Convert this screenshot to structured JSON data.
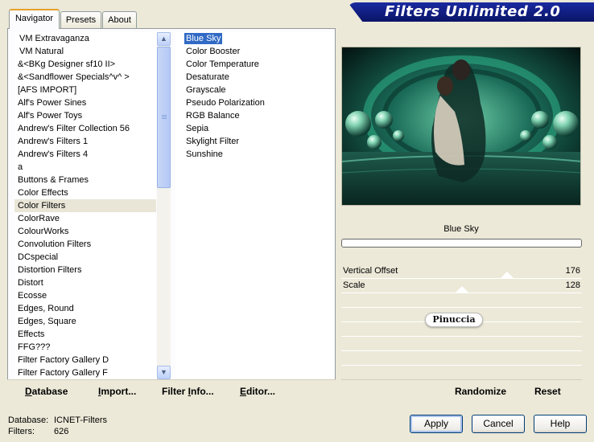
{
  "banner": {
    "title": "Filters Unlimited 2.0"
  },
  "tabs": [
    {
      "label": "Navigator",
      "active": true
    },
    {
      "label": "Presets",
      "active": false
    },
    {
      "label": "About",
      "active": false
    }
  ],
  "categories": {
    "selected": "Color Filters",
    "items": [
      "VM Extravaganza",
      "VM Natural",
      "&<BKg Designer sf10 II>",
      "&<Sandflower Specials^v^ >",
      "[AFS IMPORT]",
      "Alf's Power Sines",
      "Alf's Power Toys",
      "Andrew's Filter Collection 56",
      "Andrew's Filters 1",
      "Andrew's Filters 4",
      "a",
      "Buttons & Frames",
      "Color Effects",
      "Color Filters",
      "ColorRave",
      "ColourWorks",
      "Convolution Filters",
      "DCspecial",
      "Distortion Filters",
      "Distort",
      "Ecosse",
      "Edges, Round",
      "Edges, Square",
      "Effects",
      "FFG???",
      "Filter Factory Gallery D",
      "Filter Factory Gallery F"
    ]
  },
  "effects": {
    "selected": "Blue Sky",
    "items": [
      "Blue Sky",
      "Color Booster",
      "Color Temperature",
      "Desaturate",
      "Grayscale",
      "Pseudo Polarization",
      "RGB Balance",
      "Sepia",
      "Skylight Filter",
      "Sunshine"
    ]
  },
  "nav_buttons": [
    {
      "prefix": "",
      "underline": "D",
      "rest": "atabase"
    },
    {
      "prefix": "",
      "underline": "I",
      "rest": "mport..."
    },
    {
      "prefix": "Filter ",
      "underline": "I",
      "rest": "nfo..."
    },
    {
      "prefix": "",
      "underline": "E",
      "rest": "ditor..."
    }
  ],
  "preview": {
    "filter_name": "Blue Sky",
    "progress": 0,
    "watermark": "Pinuccia"
  },
  "sliders": [
    {
      "label": "Vertical Offset",
      "value": "176",
      "fraction": 0.69
    },
    {
      "label": "Scale",
      "value": "128",
      "fraction": 0.5
    }
  ],
  "right_buttons": {
    "randomize": "Randomize",
    "reset": "Reset"
  },
  "status": {
    "database_label": "Database:",
    "database_value": "ICNET-Filters",
    "filters_label": "Filters:",
    "filters_value": "626"
  },
  "dialog_buttons": {
    "apply": "Apply",
    "cancel": "Cancel",
    "help": "Help"
  },
  "colors": {
    "banner": "#0a1466",
    "selection": "#316ac5",
    "face": "#ece9d8"
  }
}
